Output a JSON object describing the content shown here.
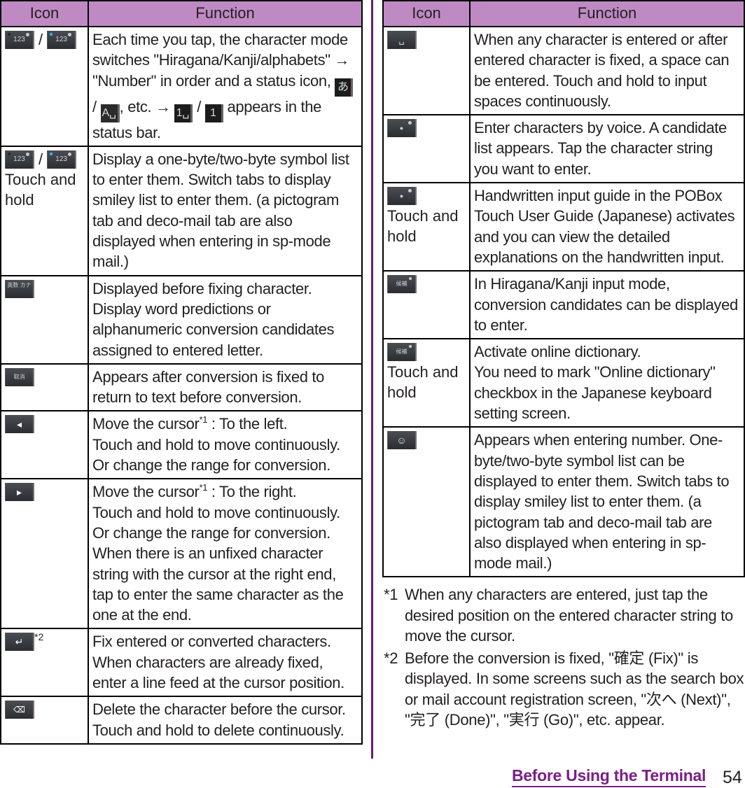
{
  "header": {
    "icon_label": "Icon",
    "function_label": "Function"
  },
  "left_table": [
    {
      "icons": [
        "123-mode-key-icon",
        "123-mode-key-active-icon"
      ],
      "icon_note": "",
      "function": {
        "part1": "Each time you tap, the character mode switches \"Hiragana/Kanji/alphabets\" → \"Number\" in order and a status icon, ",
        "status_icon_1": "あ",
        "part2": " / ",
        "status_icon_2": "A␣",
        "part3": ", etc. → ",
        "status_icon_3": "1␣",
        "part4": " / ",
        "status_icon_4": "1",
        "part5": " appears in the status bar."
      }
    },
    {
      "icons": [
        "123-mode-key-icon",
        "123-mode-key-active-icon"
      ],
      "icon_note": "Touch and hold",
      "function": "Display a one-byte/two-byte symbol list to enter them. Switch tabs to display smiley list to enter them. (a pictogram tab and deco-mail tab are also displayed when entering in sp-mode mail.)"
    },
    {
      "icons": [
        "eisu-kana-key-icon"
      ],
      "icon_glyph": "英数 カナ",
      "icon_note": "",
      "function": "Displayed before fixing character. Display word predictions or alphanumeric conversion candidates assigned to entered letter."
    },
    {
      "icons": [
        "undo-key-icon"
      ],
      "icon_glyph": "取消",
      "icon_note": "",
      "function": "Appears after conversion is fixed to return to text before conversion."
    },
    {
      "icons": [
        "cursor-left-key-icon"
      ],
      "icon_glyph": "◂",
      "icon_note": "",
      "function_main": "Move the cursor",
      "function_sup": "*1",
      "function_rest": " : To the left.\nTouch and hold to move continuously.\nOr change the range for conversion."
    },
    {
      "icons": [
        "cursor-right-key-icon"
      ],
      "icon_glyph": "▸",
      "icon_note": "",
      "function_main": "Move the cursor",
      "function_sup": "*1",
      "function_rest": " : To the right.\nTouch and hold to move continuously.\nOr change the range for conversion.\nWhen there is an unfixed character string with the cursor at the right end, tap to enter the same character as the one at the end."
    },
    {
      "icons": [
        "enter-key-icon"
      ],
      "icon_glyph": "↵",
      "icon_sup": "*2",
      "icon_note": "",
      "function": "Fix entered or converted characters.\nWhen characters are already fixed, enter a line feed at the cursor position."
    },
    {
      "icons": [
        "backspace-key-icon"
      ],
      "icon_glyph": "⌫",
      "icon_note": "",
      "function": "Delete the character before the cursor.\nTouch and hold to delete continuously."
    }
  ],
  "right_table": [
    {
      "icons": [
        "space-key-icon"
      ],
      "icon_glyph": "␣",
      "icon_note": "",
      "function": "When any character is entered or after entered character is fixed, a space can be entered. Touch and hold to input spaces continuously."
    },
    {
      "icons": [
        "voice-input-key-icon"
      ],
      "icon_glyph": "●",
      "icon_note": "",
      "function": "Enter characters by voice. A candidate list appears. Tap the character string you want to enter."
    },
    {
      "icons": [
        "voice-input-key-icon"
      ],
      "icon_glyph": "●",
      "icon_note": "Touch and hold",
      "function": "Handwritten input guide in the POBox Touch User Guide (Japanese) activates and you can view the detailed explanations on the handwritten input."
    },
    {
      "icons": [
        "candidate-key-icon"
      ],
      "icon_glyph": "候補",
      "icon_note": "",
      "function": "In Hiragana/Kanji input mode, conversion candidates can be displayed to enter."
    },
    {
      "icons": [
        "candidate-key-icon"
      ],
      "icon_glyph": "候補",
      "icon_note": "Touch and hold",
      "function": "Activate online dictionary.\nYou need to mark \"Online dictionary\" checkbox in the Japanese keyboard setting screen."
    },
    {
      "icons": [
        "smiley-key-icon"
      ],
      "icon_glyph": "☺",
      "icon_note": "",
      "function": "Appears when entering number. One-byte/two-byte symbol list can be displayed to enter them. Switch tabs to display smiley list to enter them. (a pictogram tab and deco-mail tab are also displayed when entering in sp-mode mail.)"
    }
  ],
  "notes": [
    {
      "mark": "*1",
      "text": "When any characters are entered, just tap the desired position on the entered character string to move the cursor."
    },
    {
      "mark": "*2",
      "text": "Before the conversion is fixed, \"確定 (Fix)\" is displayed. In some screens such as the search box or mail account registration screen, \"次へ (Next)\", \"完了 (Done)\", \"実行 (Go)\", etc. appear."
    }
  ],
  "footer": {
    "section_title": "Before Using the Terminal",
    "page_number": "54"
  },
  "colors": {
    "header_bg": "#bf8ac4",
    "accent_purple": "#7a1f86",
    "divider": "#6a1b75"
  }
}
